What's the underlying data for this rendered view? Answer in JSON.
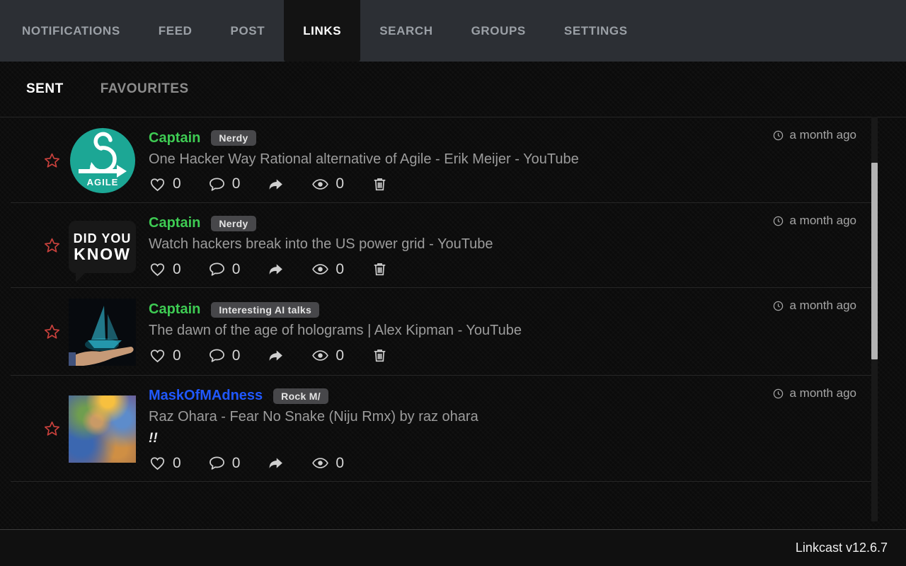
{
  "nav": {
    "items": [
      {
        "label": "NOTIFICATIONS",
        "active": false
      },
      {
        "label": "FEED",
        "active": false
      },
      {
        "label": "POST",
        "active": false
      },
      {
        "label": "LINKS",
        "active": true
      },
      {
        "label": "SEARCH",
        "active": false
      },
      {
        "label": "GROUPS",
        "active": false
      },
      {
        "label": "SETTINGS",
        "active": false
      }
    ]
  },
  "subnav": {
    "items": [
      {
        "label": "SENT",
        "active": true
      },
      {
        "label": "FAVOURITES",
        "active": false
      }
    ]
  },
  "posts": [
    {
      "user": "Captain",
      "user_color": "#3ecb53",
      "badge": "Nerdy",
      "title": "One Hacker Way Rational alternative of Agile - Erik Meijer - YouTube",
      "time": "a month ago",
      "likes": "0",
      "comments": "0",
      "views": "0",
      "deletable": true,
      "thumbnail": "agile-logo",
      "thumb_label": "AGILE"
    },
    {
      "user": "Captain",
      "user_color": "#3ecb53",
      "badge": "Nerdy",
      "title": "Watch hackers break into the US power grid - YouTube",
      "time": "a month ago",
      "likes": "0",
      "comments": "0",
      "views": "0",
      "deletable": true,
      "thumbnail": "did-you-know-bubble",
      "thumb_line1": "DID YOU",
      "thumb_line2": "KNOW"
    },
    {
      "user": "Captain",
      "user_color": "#3ecb53",
      "badge": "Interesting AI talks",
      "title": "The dawn of the age of holograms | Alex Kipman - YouTube",
      "time": "a month ago",
      "likes": "0",
      "comments": "0",
      "views": "0",
      "deletable": true,
      "thumbnail": "hologram-ship-on-hand"
    },
    {
      "user": "MaskOfMAdness",
      "user_color": "#2058ff",
      "badge": "Rock M/",
      "title": "Raz Ohara - Fear No Snake (Niju Rmx) by raz ohara",
      "note": "!!",
      "time": "a month ago",
      "likes": "0",
      "comments": "0",
      "views": "0",
      "deletable": false,
      "thumbnail": "fantasy-painting"
    }
  ],
  "footer": {
    "version": "Linkcast v12.6.7"
  },
  "icons": {
    "favourite-star": "red outline star",
    "like": "heart outline",
    "comment": "speech bubble outline",
    "share": "curved forward arrow",
    "views": "eye",
    "delete": "trash can",
    "timestamp": "clock"
  },
  "colors": {
    "nav_bg": "#2c2f34",
    "active_tab_bg": "#131313",
    "page_bg": "#0b0b0b",
    "accent_green": "#3ecb53",
    "accent_blue": "#2058ff",
    "star_red": "#c9413c",
    "badge_bg": "#47474a",
    "agile_teal": "#1ca795",
    "scrollbar_thumb": "#b3b3b3"
  }
}
